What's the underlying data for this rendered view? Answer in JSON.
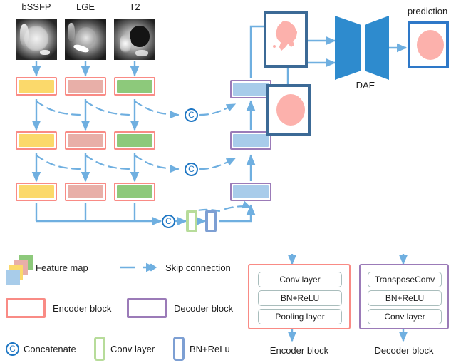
{
  "figure": {
    "kind": "neural-network-architecture-diagram",
    "subject": "Multi-modal cardiac MRI segmentation network with denoising auto-encoder shape refinement"
  },
  "inputs": {
    "modalities": [
      {
        "label": "bSSFP",
        "icon": "cardiac-mri-slice-icon"
      },
      {
        "label": "LGE",
        "icon": "cardiac-mri-slice-icon"
      },
      {
        "label": "T2",
        "icon": "cardiac-mri-slice-icon"
      }
    ]
  },
  "encoder": {
    "columns": [
      "bSSFP",
      "LGE",
      "T2"
    ],
    "levels": 3,
    "fills": [
      "yellow",
      "pink",
      "green"
    ],
    "fill_colors": {
      "yellow": "#FBD96B",
      "pink": "#E8AFA8",
      "green": "#8DC97B"
    },
    "border_color": "#F98B85"
  },
  "decoder": {
    "levels": 3,
    "fill_color": "#A8CCEA",
    "border_color": "#9B7BB8"
  },
  "bottleneck": {
    "conv_label": "Conv layer",
    "bn_label": "BN+ReLu"
  },
  "concatenate": {
    "glyph": "C",
    "count": 3,
    "color": "#1F77C4"
  },
  "dae": {
    "label": "DAE",
    "color": "#2E8BCE"
  },
  "outputs": {
    "coarse_mask": {
      "shape": "irregular-segmentation-mask",
      "color": "#FCB1AC"
    },
    "prior_mask": {
      "shape": "round-segmentation-mask",
      "color": "#FCB1AC"
    },
    "prediction": {
      "label": "prediction",
      "shape": "round-segmentation-mask",
      "color": "#FCB1AC"
    }
  },
  "legend": {
    "items": [
      {
        "label": "Feature map",
        "icon": "stacked-feature-map-icon"
      },
      {
        "label": "Skip connection",
        "icon": "dashed-arrow-icon"
      },
      {
        "label": "Encoder block",
        "icon": "red-rectangle-icon"
      },
      {
        "label": "Decoder block",
        "icon": "purple-rectangle-icon"
      },
      {
        "label": "Concatenate",
        "icon": "circled-c-icon"
      },
      {
        "label": "Conv layer",
        "icon": "green-rectangle-icon"
      },
      {
        "label": "BN+ReLu",
        "icon": "blue-rectangle-icon"
      }
    ],
    "feature_map_colors": [
      "#8DC97B",
      "#E8AFA8",
      "#FBD96B",
      "#A8CCEA"
    ]
  },
  "detail_panels": [
    {
      "caption": "Encoder block",
      "kind": "encoder",
      "layers": [
        "Conv layer",
        "BN+ReLU",
        "Pooling layer"
      ]
    },
    {
      "caption": "Decoder block",
      "kind": "decoder",
      "layers": [
        "TransposeConv",
        "BN+ReLU",
        "Conv layer"
      ]
    }
  ]
}
